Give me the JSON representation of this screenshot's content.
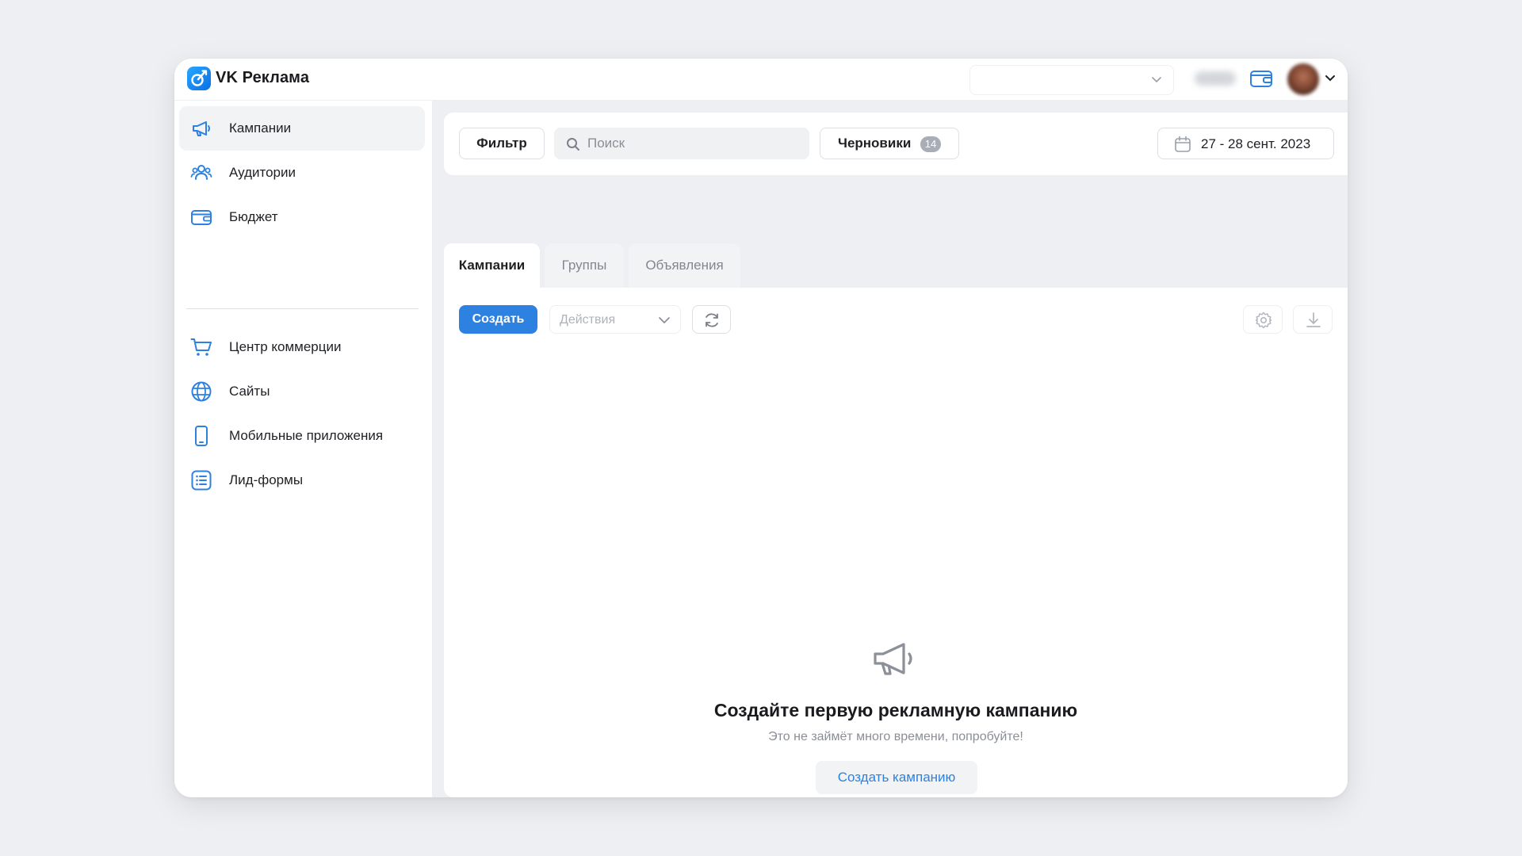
{
  "app": {
    "brand": "VK Реклама",
    "accent_color": "#2d81e0",
    "logo_color": "#1b8cf2"
  },
  "header": {
    "account_select_value": "",
    "balance_text": "",
    "icons": [
      "chevron-down-icon",
      "wallet-icon",
      "avatar",
      "chevron-down-icon"
    ]
  },
  "sidebar": {
    "items": [
      {
        "label": "Кампании",
        "icon": "megaphone-icon",
        "active": true
      },
      {
        "label": "Аудитории",
        "icon": "users-icon",
        "active": false
      },
      {
        "label": "Бюджет",
        "icon": "wallet-icon",
        "active": false
      },
      {
        "label": "Центр коммерции",
        "icon": "cart-icon",
        "active": false
      },
      {
        "label": "Сайты",
        "icon": "globe-icon",
        "active": false
      },
      {
        "label": "Мобильные приложения",
        "icon": "smartphone-icon",
        "active": false
      },
      {
        "label": "Лид-формы",
        "icon": "list-icon",
        "active": false
      }
    ]
  },
  "toolbar": {
    "filter_label": "Фильтр",
    "search_placeholder": "Поиск",
    "drafts_label": "Черновики",
    "drafts_count": "14",
    "date_range": "27 - 28 сент. 2023"
  },
  "tabs": [
    {
      "label": "Кампании",
      "active": true
    },
    {
      "label": "Группы",
      "active": false
    },
    {
      "label": "Объявления",
      "active": false
    }
  ],
  "actions": {
    "create_label": "Создать",
    "actions_placeholder": "Действия"
  },
  "empty_state": {
    "title": "Создайте первую рекламную кампанию",
    "subtitle": "Это не займёт много времени, попробуйте!",
    "button_label": "Создать кампанию"
  }
}
